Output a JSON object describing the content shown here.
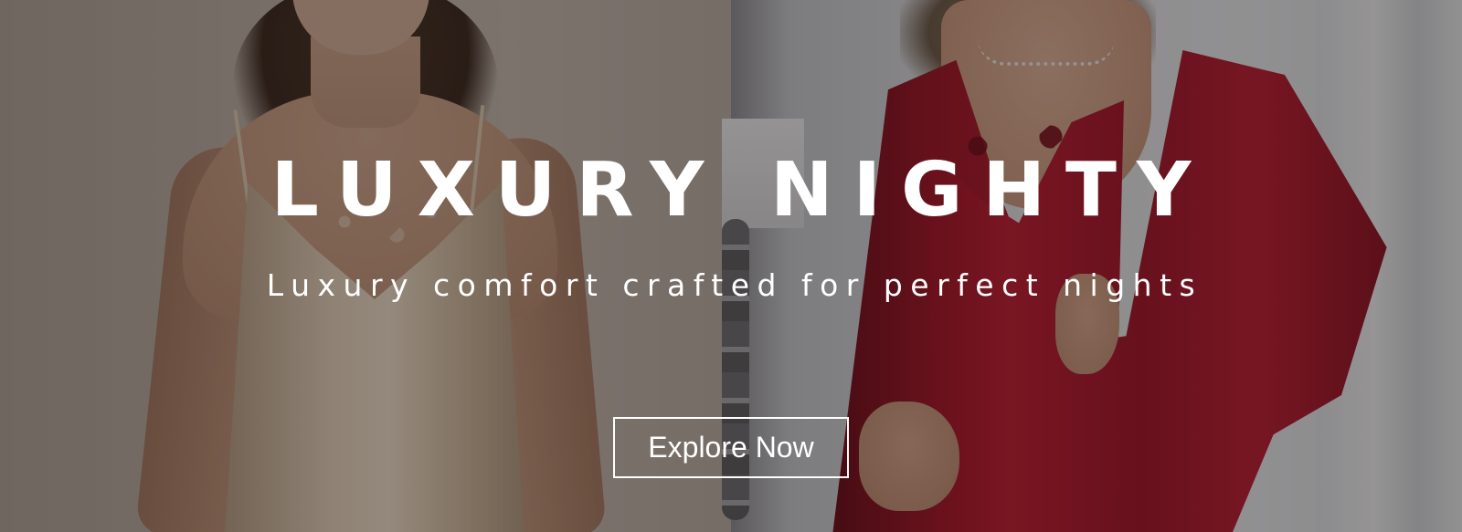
{
  "hero": {
    "title": "LUXURY NIGHTY",
    "subtitle": "Luxury comfort crafted for perfect nights",
    "cta_label": "Explore Now"
  },
  "colors": {
    "text": "#ffffff",
    "button_border": "#ffffff",
    "overlay": "rgba(20,14,14,0.42)",
    "left_garment": "#e8d6bf",
    "right_garment": "#b8192d"
  }
}
